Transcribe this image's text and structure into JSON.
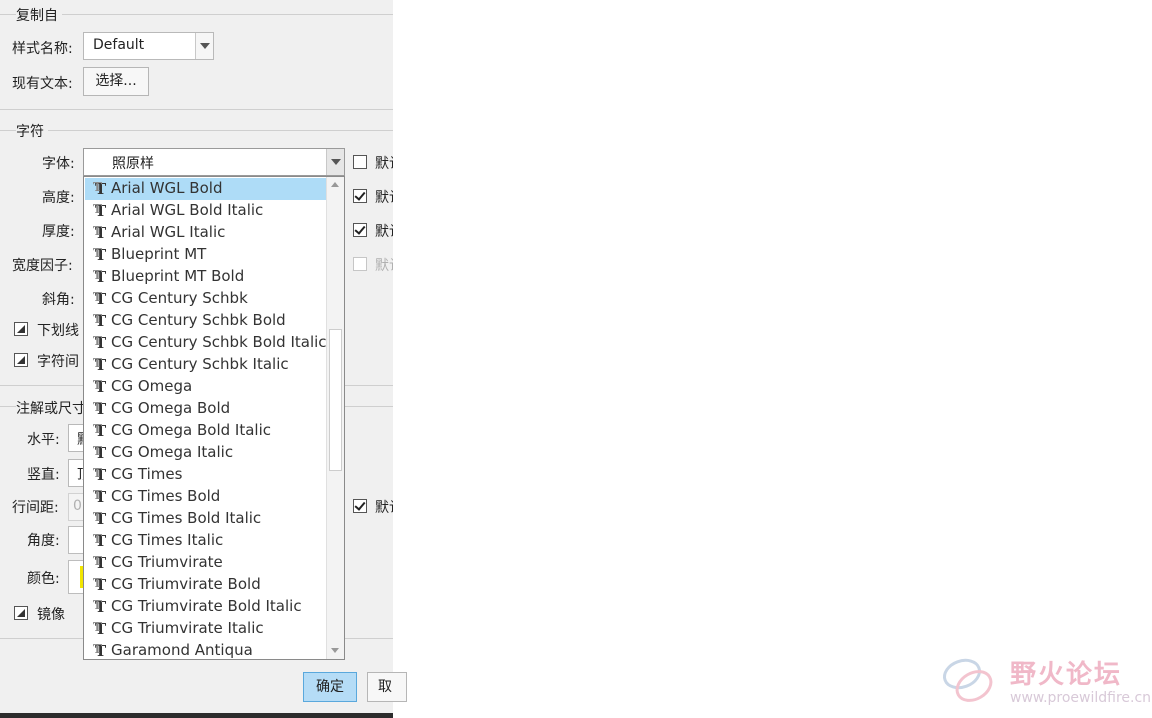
{
  "copy_from": {
    "title": "复制自",
    "style_name_label": "样式名称:",
    "style_name_value": "Default",
    "existing_text_label": "现有文本:",
    "select_button": "选择..."
  },
  "character": {
    "title": "字符",
    "font_label": "字体:",
    "font_value": "照原样",
    "height_label": "高度:",
    "thickness_label": "厚度:",
    "width_factor_label": "宽度因子:",
    "slant_label": "斜角:",
    "underline_label": "下划线",
    "char_spacing_label": "字符间",
    "default_label": "默认"
  },
  "note": {
    "title": "注解或尺寸",
    "horizontal_label": "水平:",
    "horizontal_value": "默",
    "vertical_label": "竖直:",
    "vertical_value": "顶",
    "line_spacing_label": "行间距:",
    "line_spacing_value": "0.",
    "angle_label": "角度:",
    "color_label": "颜色:",
    "mirror_label": "镜像",
    "default_label": "默认"
  },
  "checkboxes": [
    {
      "label": "默认",
      "checked": false,
      "enabled": true
    },
    {
      "label": "默认",
      "checked": true,
      "enabled": true
    },
    {
      "label": "默认",
      "checked": true,
      "enabled": true
    },
    {
      "label": "默认",
      "checked": false,
      "enabled": false
    },
    {
      "label": "默认",
      "checked": true,
      "enabled": true
    }
  ],
  "font_list": {
    "selected": "Arial WGL Bold",
    "items": [
      "Arial WGL Bold",
      "Arial WGL Bold Italic",
      "Arial WGL Italic",
      "Blueprint MT",
      "Blueprint MT Bold",
      "CG Century Schbk",
      "CG Century Schbk Bold",
      "CG Century Schbk Bold Italic",
      "CG Century Schbk Italic",
      "CG Omega",
      "CG Omega Bold",
      "CG Omega Bold Italic",
      "CG Omega Italic",
      "CG Times",
      "CG Times Bold",
      "CG Times Bold Italic",
      "CG Times Italic",
      "CG Triumvirate",
      "CG Triumvirate Bold",
      "CG Triumvirate Bold Italic",
      "CG Triumvirate Italic",
      "Garamond Antiqua"
    ]
  },
  "buttons": {
    "ok": "确定",
    "cancel": "取"
  },
  "colors": {
    "color_swatch": "#f2e600",
    "selected_item": "#aedcf7",
    "ok_button": "#b5dcf6"
  },
  "watermark": {
    "title": "野火论坛",
    "url": "www.proewildfire.cn"
  }
}
